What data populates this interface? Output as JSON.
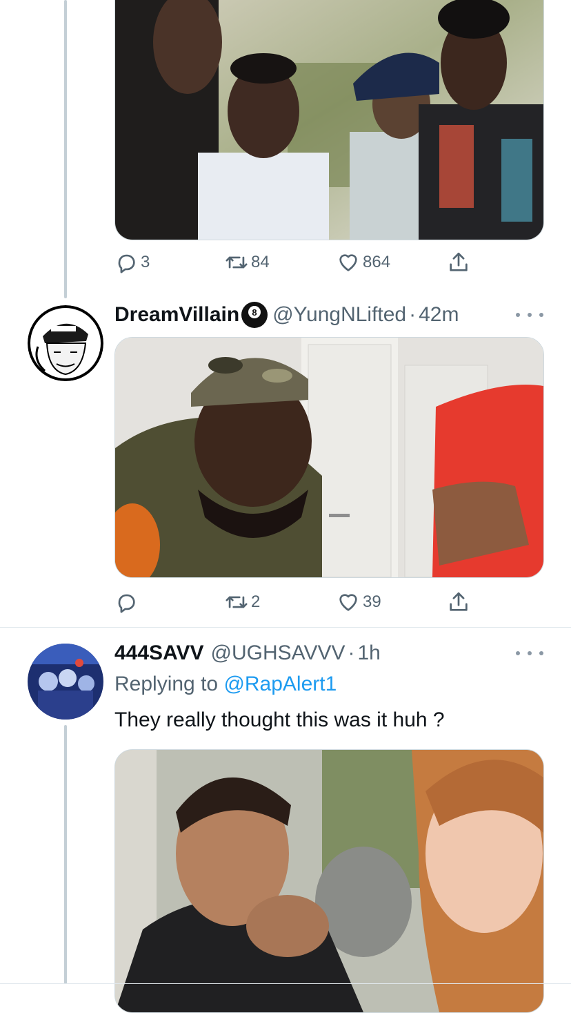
{
  "tweet1": {
    "actions": {
      "replies": "3",
      "retweets": "84",
      "likes": "864"
    }
  },
  "tweet2": {
    "display_name": "DreamVillain",
    "handle": "@YungNLifted",
    "separator": "·",
    "time": "42m",
    "badge_icon": "8-ball-icon",
    "actions": {
      "replies": "",
      "retweets": "2",
      "likes": "39"
    }
  },
  "tweet3": {
    "display_name": "444SAVV",
    "handle": "@UGHSAVVV",
    "separator": "·",
    "time": "1h",
    "reply_prefix": "Replying to ",
    "reply_mention": "@RapAlert1",
    "text": "They really thought this was it huh ?"
  },
  "colors": {
    "accent": "#1d9bf0",
    "muted": "#536471",
    "text": "#0f1419",
    "thread_line": "#c4cfd6"
  }
}
